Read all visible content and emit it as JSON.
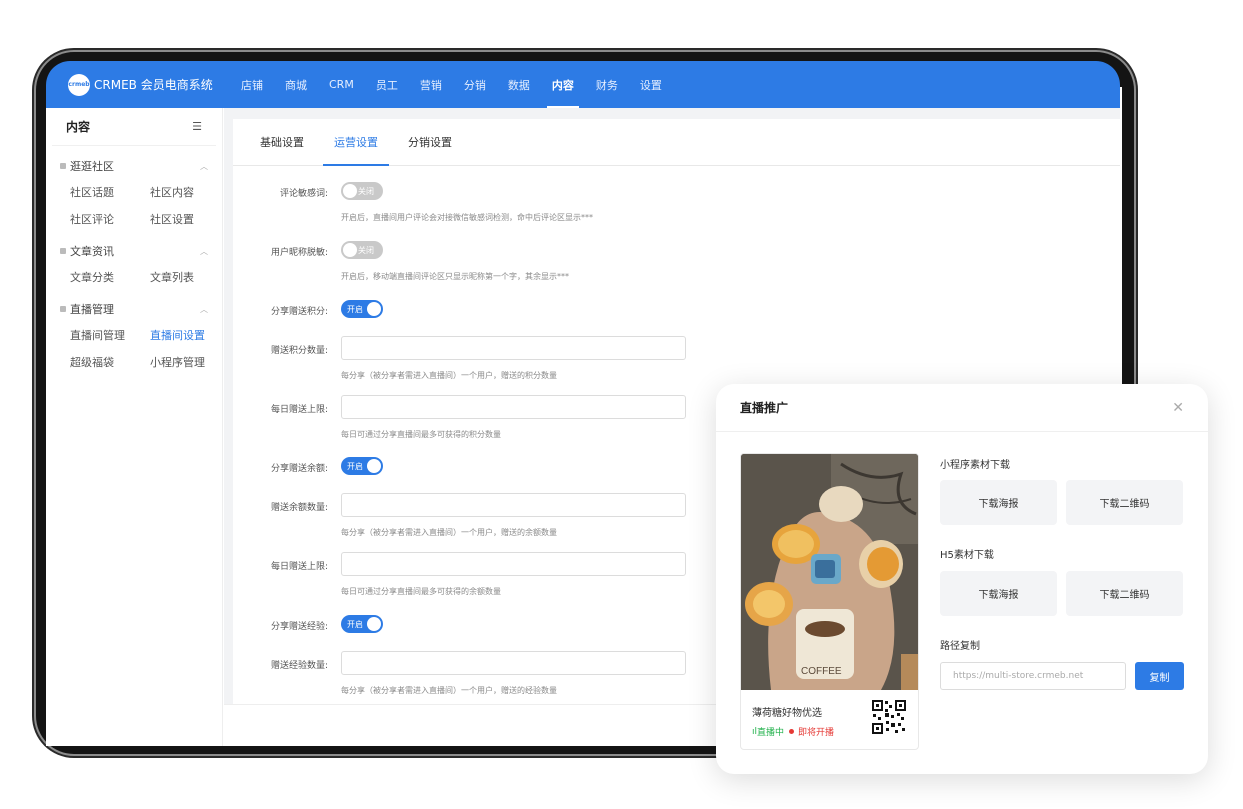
{
  "app": {
    "logo_badge": "crmeb",
    "title": "CRMEB 会员电商系统"
  },
  "topnav": {
    "items": [
      {
        "label": "店铺"
      },
      {
        "label": "商城"
      },
      {
        "label": "CRM"
      },
      {
        "label": "员工"
      },
      {
        "label": "营销"
      },
      {
        "label": "分销"
      },
      {
        "label": "数据"
      },
      {
        "label": "内容",
        "active": true
      },
      {
        "label": "财务"
      },
      {
        "label": "设置"
      }
    ]
  },
  "sidebar": {
    "title": "内容",
    "collapse_icon": "menu-fold-icon",
    "groups": [
      {
        "title": "逛逛社区",
        "items": [
          "社区话题",
          "社区内容",
          "社区评论",
          "社区设置"
        ]
      },
      {
        "title": "文章资讯",
        "items": [
          "文章分类",
          "文章列表"
        ]
      },
      {
        "title": "直播管理",
        "items": [
          "直播间管理",
          "直播间设置",
          "超级福袋",
          "小程序管理"
        ],
        "active": "直播间设置"
      }
    ]
  },
  "tabs": [
    {
      "label": "基础设置"
    },
    {
      "label": "运营设置",
      "active": true
    },
    {
      "label": "分销设置"
    }
  ],
  "form": {
    "comment_sensitive": {
      "label": "评论敏感词:",
      "switch": "关闭",
      "hint": "开启后，直播间用户评论会对接微信敏感词检测，命中后评论区显示***"
    },
    "nickname_mask": {
      "label": "用户昵称脱敏:",
      "switch": "关闭",
      "hint": "开启后，移动端直播间评论区只显示昵称第一个字，其余显示***"
    },
    "share_points": {
      "label": "分享赠送积分:",
      "switch": "开启"
    },
    "points_amount": {
      "label": "赠送积分数量:",
      "value": "",
      "hint": "每分享（被分享者需进入直播间）一个用户，赠送的积分数量"
    },
    "points_daily_limit": {
      "label": "每日赠送上限:",
      "value": "",
      "hint": "每日可通过分享直播间最多可获得的积分数量"
    },
    "share_balance": {
      "label": "分享赠送余额:",
      "switch": "开启"
    },
    "balance_amount": {
      "label": "赠送余额数量:",
      "value": "",
      "hint": "每分享（被分享者需进入直播间）一个用户，赠送的余额数量"
    },
    "balance_daily_limit": {
      "label": "每日赠送上限:",
      "value": "",
      "hint": "每日可通过分享直播间最多可获得的余额数量"
    },
    "share_exp": {
      "label": "分享赠送经验:",
      "switch": "开启"
    },
    "exp_amount": {
      "label": "赠送经验数量:",
      "value": "",
      "hint": "每分享（被分享者需进入直播间）一个用户，赠送的经验数量"
    }
  },
  "popup": {
    "title": "直播推广",
    "close_icon": "close-icon",
    "card": {
      "name": "薄荷糖好物优选",
      "live_label": "直播中",
      "soon_label": "即将开播",
      "live_icon": "bar-chart-icon"
    },
    "miniapp": {
      "label": "小程序素材下载",
      "poster_btn": "下载海报",
      "qrcode_btn": "下载二维码"
    },
    "h5": {
      "label": "H5素材下载",
      "poster_btn": "下载海报",
      "qrcode_btn": "下载二维码"
    },
    "path": {
      "label": "路径复制",
      "url": "https://multi-store.crmeb.net",
      "copy_btn": "复制"
    }
  },
  "colors": {
    "primary": "#2d7be5",
    "live_green": "#22b14c",
    "soon_red": "#e53935"
  }
}
